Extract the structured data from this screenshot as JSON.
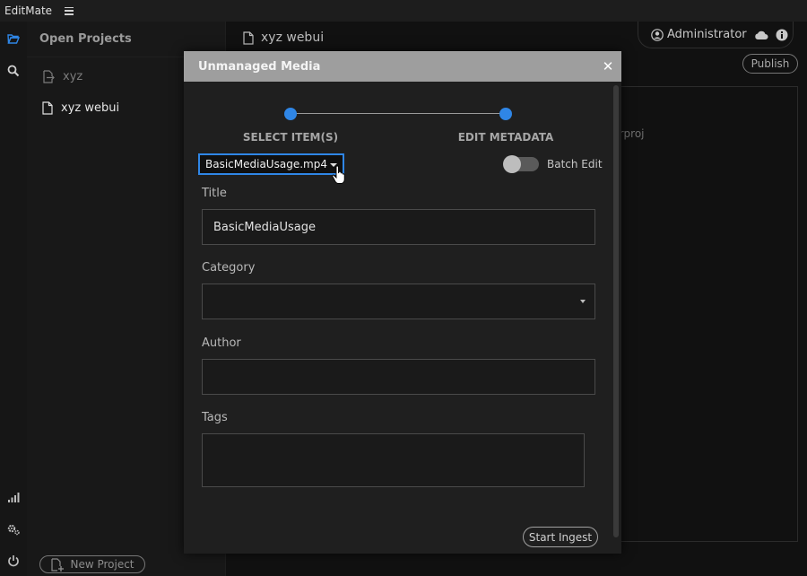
{
  "app": {
    "title": "EditMate"
  },
  "projects_panel": {
    "header": "Open Projects",
    "items": [
      {
        "label": "xyz",
        "icon": "export-file-icon",
        "state": "dim"
      },
      {
        "label": "xyz webui",
        "icon": "document-icon",
        "state": "active"
      }
    ],
    "new_project_label": "New Project"
  },
  "main": {
    "project_title": "xyz webui",
    "user_name": "Administrator",
    "publish_label": "Publish",
    "partial_text": "prproj"
  },
  "rail": {
    "icons": [
      "folder-open-icon",
      "search-icon",
      "signal-icon",
      "settings-icon",
      "power-icon"
    ]
  },
  "modal": {
    "title": "Unmanaged Media",
    "close_symbol": "✕",
    "steps": [
      "SELECT ITEM(S)",
      "EDIT METADATA"
    ],
    "step_color": "#2f86e6",
    "selected_file": "BasicMediaUsage.mp4",
    "batch_edit_label": "Batch Edit",
    "batch_edit_on": false,
    "fields": {
      "title": {
        "label": "Title",
        "value": "BasicMediaUsage"
      },
      "category": {
        "label": "Category",
        "value": ""
      },
      "author": {
        "label": "Author",
        "value": ""
      },
      "tags": {
        "label": "Tags",
        "value": ""
      }
    },
    "start_label": "Start Ingest"
  }
}
